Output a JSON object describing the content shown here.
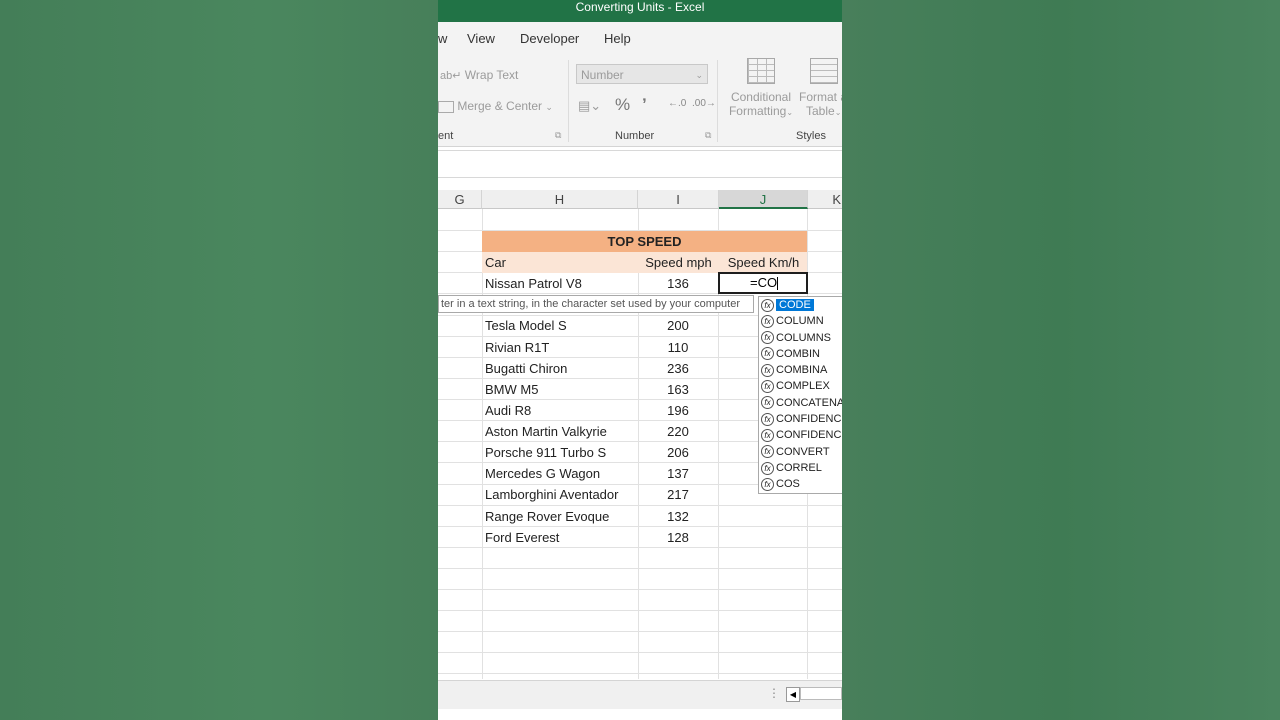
{
  "window": {
    "title": "Converting Units  -  Excel"
  },
  "menu": {
    "items": [
      "w",
      "View",
      "Developer",
      "Help"
    ]
  },
  "ribbon": {
    "wrap_text": "Wrap Text",
    "merge_center": "Merge & Center",
    "alignment_group": "ent",
    "number_format": "Number",
    "percent": "%",
    "comma": "ʼ",
    "number_group": "Number",
    "conditional_formatting": [
      "Conditional",
      "Formatting"
    ],
    "format_as_table": [
      "Format a",
      "Table"
    ],
    "styles_group": "Styles"
  },
  "columns": [
    "G",
    "H",
    "I",
    "J",
    "K"
  ],
  "sheet": {
    "title": "TOP SPEED",
    "headers": [
      "Car",
      "Speed mph",
      "Speed Km/h"
    ],
    "rows": [
      [
        "Nissan Patrol V8",
        "136"
      ],
      [
        "Tesla Model S",
        "200"
      ],
      [
        "Rivian R1T",
        "110"
      ],
      [
        "Bugatti Chiron",
        "236"
      ],
      [
        "BMW M5",
        "163"
      ],
      [
        "Audi R8",
        "196"
      ],
      [
        "Aston Martin Valkyrie",
        "220"
      ],
      [
        "Porsche 911 Turbo S",
        "206"
      ],
      [
        "Mercedes G Wagon",
        "137"
      ],
      [
        "Lamborghini Aventador",
        "217"
      ],
      [
        "Range Rover Evoque",
        "132"
      ],
      [
        "Ford Everest",
        "128"
      ]
    ],
    "active_cell_value": "=CO"
  },
  "tooltip": "ter in a text string, in the character set used by your computer",
  "autocomplete": {
    "items": [
      "CODE",
      "COLUMN",
      "COLUMNS",
      "COMBIN",
      "COMBINA",
      "COMPLEX",
      "CONCATENAT",
      "CONFIDENCE",
      "CONFIDENCE",
      "CONVERT",
      "CORREL",
      "COS"
    ],
    "selected_index": 0
  },
  "colors": {
    "excel_green": "#217346",
    "header_fill": "#f4b183",
    "subheader_fill": "#fbe5d6",
    "selection": "#0078d7"
  }
}
